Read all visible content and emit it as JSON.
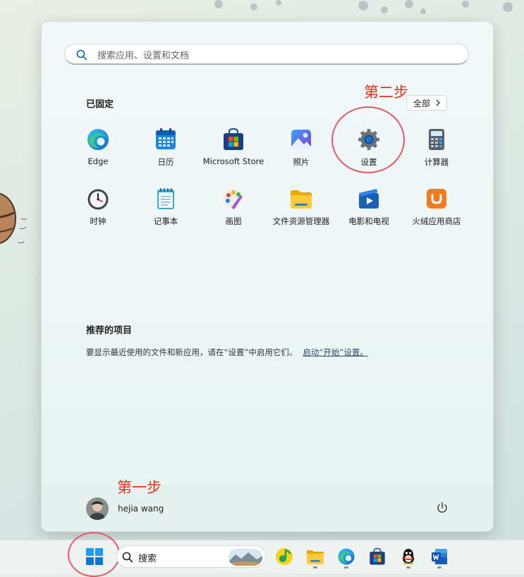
{
  "search": {
    "placeholder": "搜索应用、设置和文档"
  },
  "pinned": {
    "title": "已固定",
    "all_label": "全部",
    "apps": [
      {
        "label": "Edge",
        "icon": "edge-icon"
      },
      {
        "label": "日历",
        "icon": "calendar-icon"
      },
      {
        "label": "Microsoft Store",
        "icon": "store-icon"
      },
      {
        "label": "照片",
        "icon": "photos-icon"
      },
      {
        "label": "设置",
        "icon": "gear-icon"
      },
      {
        "label": "计算器",
        "icon": "calculator-icon"
      },
      {
        "label": "时钟",
        "icon": "clock-icon"
      },
      {
        "label": "记事本",
        "icon": "notepad-icon"
      },
      {
        "label": "画图",
        "icon": "paint-icon"
      },
      {
        "label": "文件资源管理器",
        "icon": "folder-icon"
      },
      {
        "label": "电影和电视",
        "icon": "movies-icon"
      },
      {
        "label": "火绒应用商店",
        "icon": "huorong-store-icon"
      }
    ]
  },
  "recommended": {
    "title": "推荐的项目",
    "text": "要显示最近使用的文件和新应用，请在“设置”中启用它们。",
    "link": "启动“开始”设置。"
  },
  "user": {
    "name": "hejia wang"
  },
  "annotations": {
    "step1": "第一步",
    "step2": "第二步"
  },
  "taskbar": {
    "search_label": "搜索"
  },
  "colors": {
    "annotation": "#e8301f",
    "ring": "#e25a62",
    "accent": "#0067c0"
  }
}
